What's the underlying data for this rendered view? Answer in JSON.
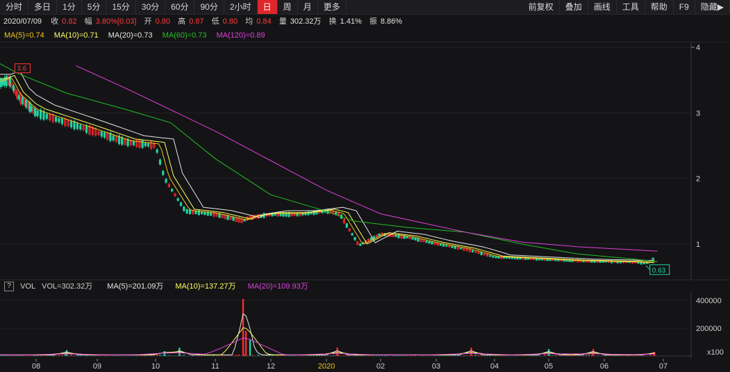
{
  "toolbar": {
    "periods": [
      "分时",
      "多日",
      "1分",
      "5分",
      "15分",
      "30分",
      "60分",
      "90分",
      "2小时",
      "日",
      "周",
      "月",
      "更多"
    ],
    "active_period": "日",
    "right_tools": [
      "前复权",
      "叠加",
      "画线",
      "工具",
      "帮助",
      "F9",
      "隐藏▶"
    ]
  },
  "info": {
    "date": "2020/07/09",
    "close_label": "收",
    "close": "0.82",
    "change_label": "幅",
    "change": "3.80%[0.03]",
    "open_label": "开",
    "open": "0.80",
    "high_label": "高",
    "high": "0.87",
    "low_label": "低",
    "low": "0.80",
    "avg_label": "均",
    "avg": "0.84",
    "volume_label": "量",
    "volume": "302.32万",
    "turnover_label": "换",
    "turnover": "1.41%",
    "amplitude_label": "振",
    "amplitude": "8.86%"
  },
  "ma_legend": [
    {
      "text": "MA(5)=0.74",
      "color": "#f0c419"
    },
    {
      "text": "MA(10)=0.71",
      "color": "#ffff66"
    },
    {
      "text": "MA(20)=0.73",
      "color": "#e8e8e8"
    },
    {
      "text": "MA(60)=0.73",
      "color": "#22c122"
    },
    {
      "text": "MA(120)=0.89",
      "color": "#e040e0"
    }
  ],
  "vol_legend": {
    "help": "?",
    "name": "VOL",
    "vol": "VOL=302.32万",
    "ma5": "MA(5)=201.09万",
    "ma10": "MA(10)=137.27万",
    "ma20": "MA(20)=109.93万"
  },
  "price_axis": {
    "ticks": [
      "4",
      "3",
      "2",
      "1"
    ],
    "high_marker": "3.6",
    "low_marker": "0.63"
  },
  "volume_axis": {
    "ticks": [
      "400000",
      "200000"
    ],
    "unit": "x100"
  },
  "time_axis": [
    "08",
    "09",
    "10",
    "11",
    "12",
    "2020",
    "02",
    "03",
    "04",
    "05",
    "06",
    "07"
  ],
  "colors": {
    "up": "#ff2b2b",
    "down": "#22d3a4",
    "bg": "#141416",
    "grid": "#2a2a30"
  },
  "chart_data": {
    "type": "candlestick",
    "price_range": [
      0.6,
      4.0
    ],
    "x_months": [
      "08",
      "09",
      "10",
      "11",
      "12",
      "2020",
      "02",
      "03",
      "04",
      "05",
      "06",
      "07"
    ],
    "price_path": [
      [
        0,
        3.45
      ],
      [
        0.5,
        3.5
      ],
      [
        1,
        3.25
      ],
      [
        2,
        3.0
      ],
      [
        3,
        2.85
      ],
      [
        4,
        2.7
      ],
      [
        5,
        2.55
      ],
      [
        6,
        2.5
      ],
      [
        6.3,
        2.0
      ],
      [
        7,
        1.5
      ],
      [
        8,
        1.45
      ],
      [
        9,
        1.35
      ],
      [
        9.2,
        1.4
      ],
      [
        10,
        1.45
      ],
      [
        11,
        1.45
      ],
      [
        12,
        1.5
      ],
      [
        12.5,
        1.45
      ],
      [
        13.2,
        0.98
      ],
      [
        14,
        1.15
      ],
      [
        15,
        1.1
      ],
      [
        16,
        1.0
      ],
      [
        17,
        0.92
      ],
      [
        18,
        0.8
      ],
      [
        19,
        0.78
      ],
      [
        20,
        0.76
      ],
      [
        21,
        0.74
      ],
      [
        22,
        0.73
      ],
      [
        23,
        0.72
      ],
      [
        23.4,
        0.7
      ],
      [
        23.8,
        0.82
      ]
    ],
    "ma120_path": [
      [
        3.3,
        3.72
      ],
      [
        5,
        3.37
      ],
      [
        8,
        2.72
      ],
      [
        12,
        1.82
      ],
      [
        14,
        1.46
      ],
      [
        17,
        1.18
      ],
      [
        19,
        1.03
      ],
      [
        21,
        0.96
      ],
      [
        23.8,
        0.89
      ]
    ],
    "ma60_path": [
      [
        0,
        3.75
      ],
      [
        1,
        3.6
      ],
      [
        3,
        3.3
      ],
      [
        5,
        3.05
      ],
      [
        6.5,
        2.85
      ],
      [
        8,
        2.3
      ],
      [
        10,
        1.75
      ],
      [
        12,
        1.5
      ],
      [
        13,
        1.35
      ],
      [
        15,
        1.25
      ],
      [
        17,
        1.18
      ],
      [
        19,
        1.0
      ],
      [
        21,
        0.85
      ],
      [
        23,
        0.77
      ],
      [
        23.8,
        0.73
      ]
    ],
    "volume_spikes": [
      {
        "x": 3.0,
        "v": 42000,
        "up": false
      },
      {
        "x": 6.3,
        "v": 35000,
        "up": false
      },
      {
        "x": 6.8,
        "v": 60000,
        "up": false
      },
      {
        "x": 9.0,
        "v": 410000,
        "up": true
      },
      {
        "x": 9.1,
        "v": 180000,
        "up": true
      },
      {
        "x": 9.25,
        "v": 120000,
        "up": false
      },
      {
        "x": 12.4,
        "v": 60000,
        "up": true
      },
      {
        "x": 17.2,
        "v": 60000,
        "up": true
      },
      {
        "x": 20.0,
        "v": 50000,
        "up": false
      },
      {
        "x": 21.6,
        "v": 50000,
        "up": true
      },
      {
        "x": 23.7,
        "v": 30000,
        "up": true
      }
    ],
    "volume_range": [
      0,
      440000
    ]
  }
}
